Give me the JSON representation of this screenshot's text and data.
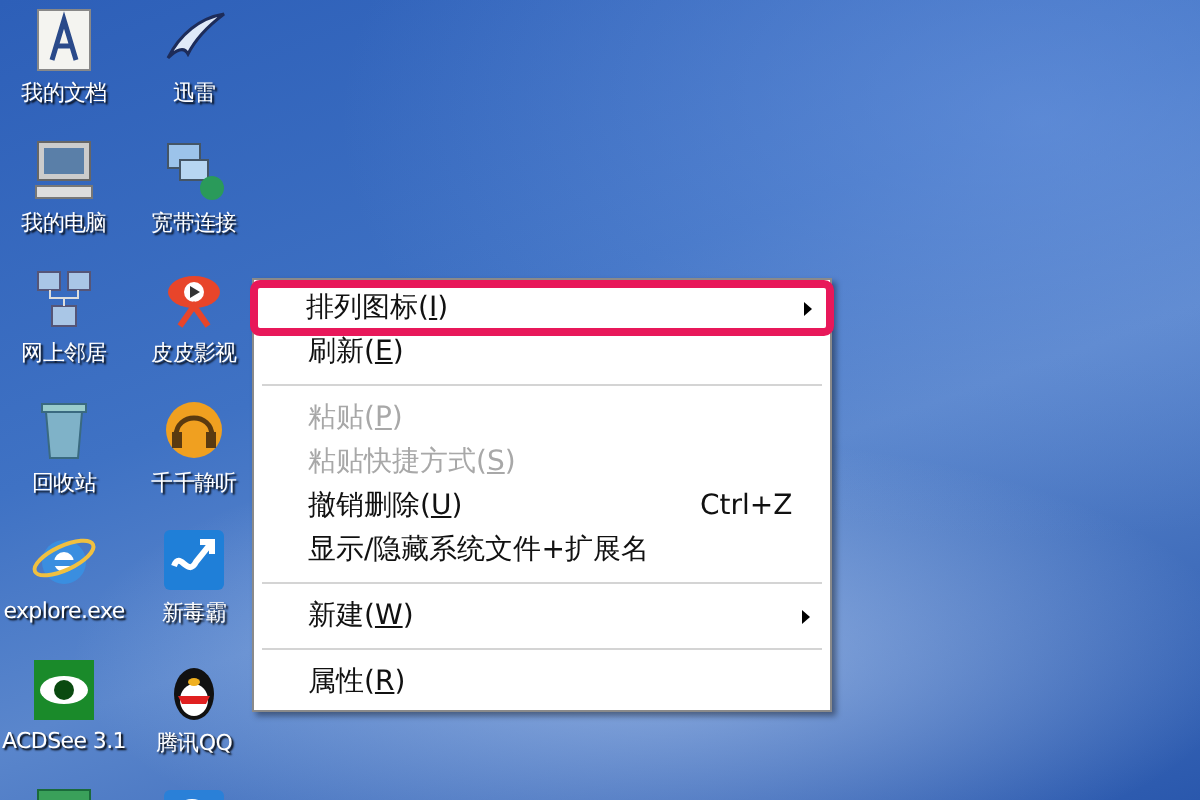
{
  "desktop_icons": [
    {
      "label": "我的文档"
    },
    {
      "label": "迅雷"
    },
    {
      "label": "我的电脑"
    },
    {
      "label": "宽带连接"
    },
    {
      "label": "网上邻居"
    },
    {
      "label": "皮皮影视"
    },
    {
      "label": "回收站"
    },
    {
      "label": "千千静听"
    },
    {
      "label": "explore.exe"
    },
    {
      "label": "新毒霸"
    },
    {
      "label": "ACDSee 3.1"
    },
    {
      "label": "腾讯QQ"
    }
  ],
  "context_menu": {
    "items": [
      {
        "kind": "item",
        "label": "排列图标(I)",
        "disabled": false,
        "submenu": true,
        "highlighted": true
      },
      {
        "kind": "item",
        "label": "刷新(E)",
        "disabled": false,
        "submenu": false,
        "highlighted": false
      },
      {
        "kind": "separator"
      },
      {
        "kind": "item",
        "label": "粘贴(P)",
        "disabled": true,
        "submenu": false,
        "highlighted": false
      },
      {
        "kind": "item",
        "label": "粘贴快捷方式(S)",
        "disabled": true,
        "submenu": false,
        "highlighted": false
      },
      {
        "kind": "item",
        "label": "撤销删除(U)",
        "shortcut": "Ctrl+Z",
        "disabled": false,
        "submenu": false,
        "highlighted": false
      },
      {
        "kind": "plain",
        "label": "显示/隐藏系统文件+扩展名",
        "disabled": false,
        "submenu": false,
        "highlighted": false
      },
      {
        "kind": "separator"
      },
      {
        "kind": "item",
        "label": "新建(W)",
        "disabled": false,
        "submenu": true,
        "highlighted": false
      },
      {
        "kind": "separator"
      },
      {
        "kind": "item",
        "label": "属性(R)",
        "disabled": false,
        "submenu": false,
        "highlighted": false
      }
    ]
  }
}
